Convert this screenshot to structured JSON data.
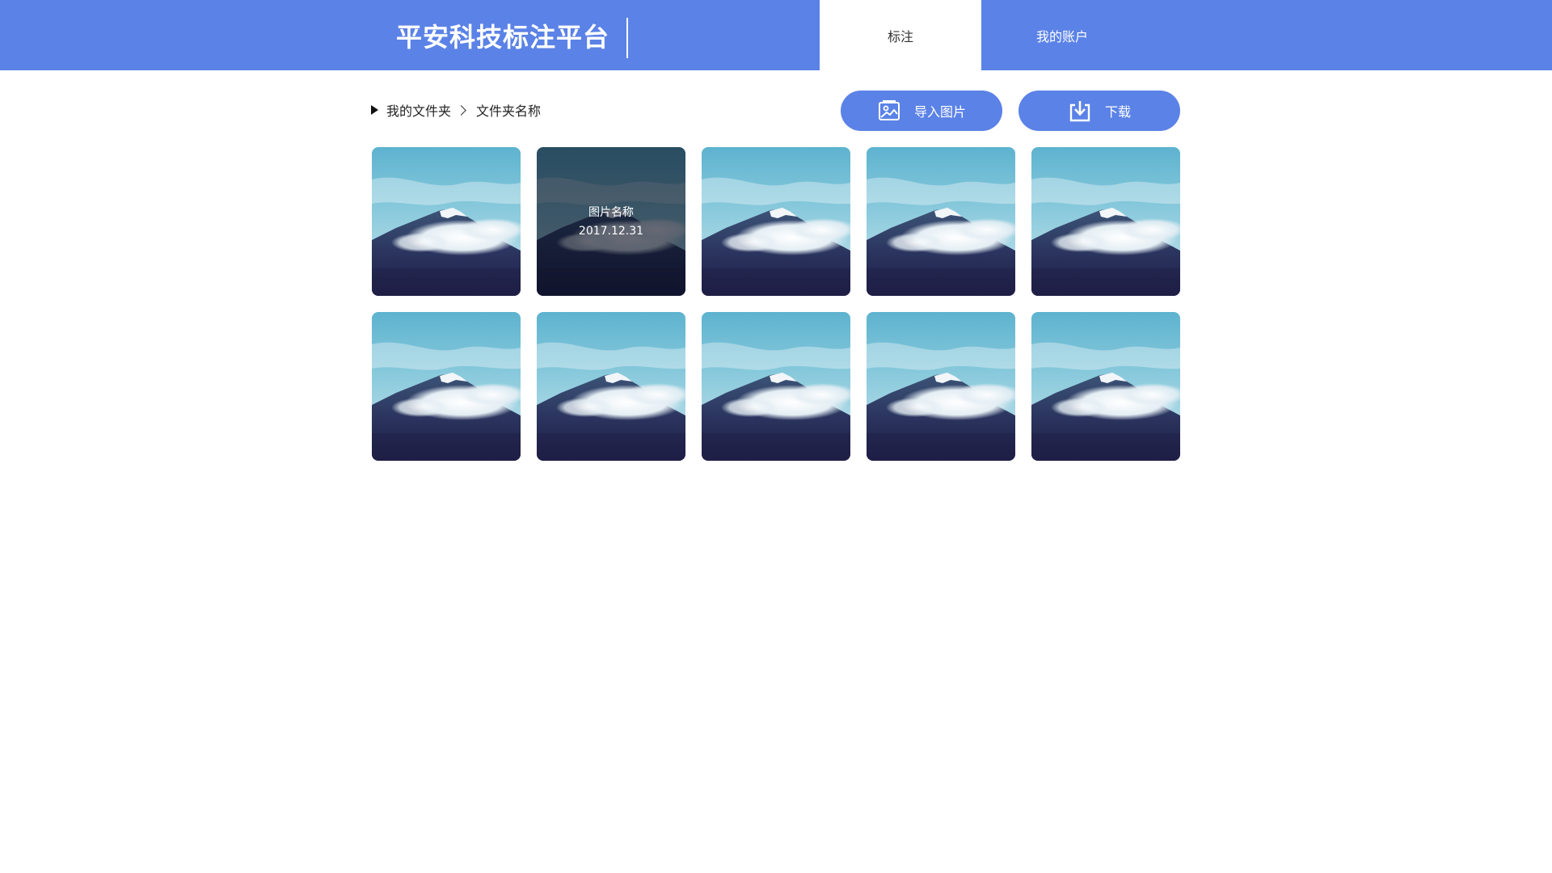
{
  "header": {
    "brand": "平安科技标注平台",
    "color": "#5B82E6",
    "tabs": [
      {
        "label": "标注",
        "active": true
      },
      {
        "label": "我的账户",
        "active": false
      }
    ]
  },
  "breadcrumb": {
    "root": "我的文件夹",
    "current": "文件夹名称"
  },
  "actions": {
    "import_label": "导入图片",
    "import_icon": "image-import-icon",
    "download_label": "下载",
    "download_icon": "download-icon"
  },
  "gallery": {
    "items": [
      {
        "hovered": false
      },
      {
        "hovered": true,
        "name": "图片名称",
        "date": "2017.12.31"
      },
      {
        "hovered": false
      },
      {
        "hovered": false
      },
      {
        "hovered": false
      },
      {
        "hovered": false
      },
      {
        "hovered": false
      },
      {
        "hovered": false
      },
      {
        "hovered": false
      },
      {
        "hovered": false
      }
    ]
  }
}
